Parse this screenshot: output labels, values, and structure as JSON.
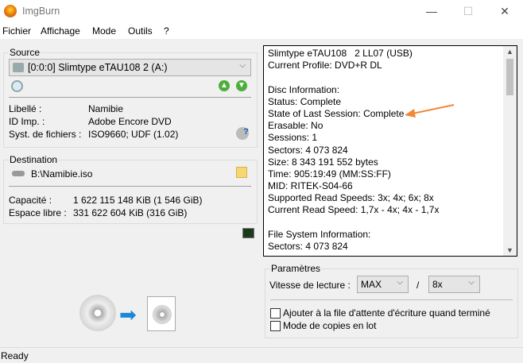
{
  "window": {
    "title": "ImgBurn",
    "min": "—",
    "max": "☐",
    "close": "✕"
  },
  "menu": [
    "Fichier",
    "Affichage",
    "Mode",
    "Outils",
    "?"
  ],
  "source": {
    "label": "Source",
    "drive": "[0:0:0] Slimtype eTAU108   2 (A:)",
    "fields": [
      {
        "k": "Libellé :",
        "v": "Namibie"
      },
      {
        "k": "ID Imp. :",
        "v": "Adobe Encore DVD"
      },
      {
        "k": "Syst. de fichiers :",
        "v": "ISO9660; UDF (1.02)"
      }
    ]
  },
  "destination": {
    "label": "Destination",
    "path": "B:\\Namibie.iso",
    "fields": [
      {
        "k": "Capacité :",
        "v": "1 622 115 148 KiB  (1 546 GiB)"
      },
      {
        "k": "Espace libre :",
        "v": "331 622 604 KiB  (316 GiB)"
      }
    ]
  },
  "info_lines": [
    "Slimtype eTAU108   2 LL07 (USB)",
    "Current Profile: DVD+R DL",
    "",
    "Disc Information:",
    "Status: Complete",
    "State of Last Session: Complete",
    "Erasable: No",
    "Sessions: 1",
    "Sectors: 4 073 824",
    "Size: 8 343 191 552 bytes",
    "Time: 905:19:49 (MM:SS:FF)",
    "MID: RITEK-S04-66",
    "Supported Read Speeds: 3x; 4x; 6x; 8x",
    "Current Read Speed: 1,7x - 4x; 4x - 1,7x",
    "",
    "File System Information:",
    "Sectors: 4 073 824"
  ],
  "params": {
    "label": "Paramètres",
    "speed_label": "Vitesse de lecture :",
    "speed1": "MAX",
    "sep": "/",
    "speed2": "8x",
    "checkboxes": [
      "Ajouter à la file d'attente d'écriture quand terminé",
      "Mode de copies en lot"
    ]
  },
  "status": "Ready",
  "colors": {
    "arrow": "#f0883a"
  }
}
